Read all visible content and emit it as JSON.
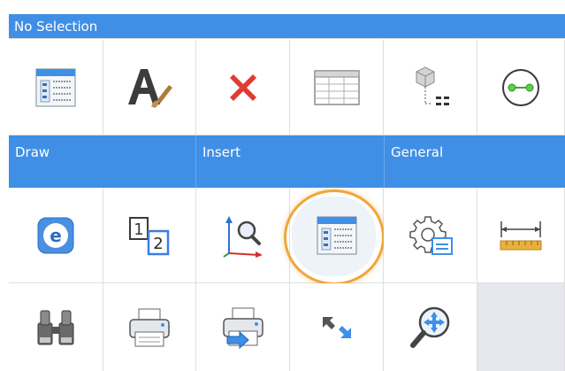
{
  "header": {
    "selection_label": "No Selection"
  },
  "sections": [
    {
      "label": "Draw"
    },
    {
      "label": "Insert"
    },
    {
      "label": "General"
    }
  ],
  "icons": {
    "row1": [
      "properties-icon",
      "text-style-icon",
      "delete-icon",
      "table-icon",
      "block-attribute-icon",
      "circle-center-icon"
    ],
    "row2": [
      "e-transmit-icon",
      "numbering-icon",
      "zoom-extents-icon",
      "properties-panel-icon",
      "settings-icon",
      "dimension-measure-icon"
    ],
    "row3": [
      "find-binoculars-icon",
      "print-icon",
      "print-export-icon",
      "fullscreen-arrows-icon",
      "pan-move-icon"
    ]
  },
  "colors": {
    "header_blue": "#3f8fe6",
    "highlight_orange": "#f0a63a",
    "delete_red": "#e03c31"
  }
}
